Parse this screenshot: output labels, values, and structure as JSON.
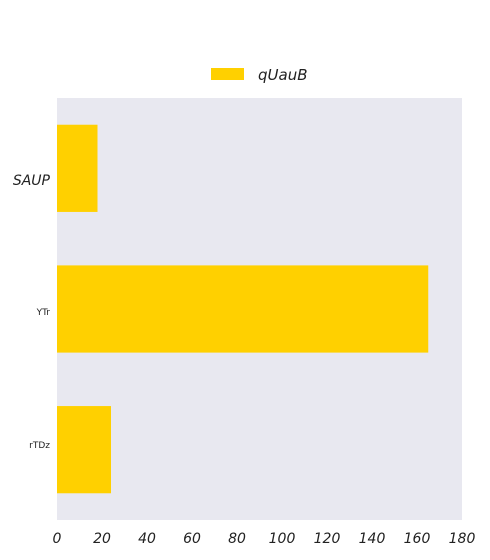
{
  "chart_data": {
    "type": "bar",
    "orientation": "horizontal",
    "categories": [
      "SAUP",
      "YTr",
      "rTDz"
    ],
    "series": [
      {
        "name": "qUauB",
        "values": [
          18,
          165,
          24
        ],
        "color": "#ffd000"
      }
    ],
    "title": "",
    "xlabel": "",
    "ylabel": "",
    "xlim": [
      0,
      180
    ],
    "xticks": [
      "0",
      "20",
      "40",
      "60",
      "80",
      "100",
      "120",
      "140",
      "160",
      "180"
    ],
    "grid": false,
    "legend_position": "top-center",
    "background_color": "#e8e8f0"
  }
}
